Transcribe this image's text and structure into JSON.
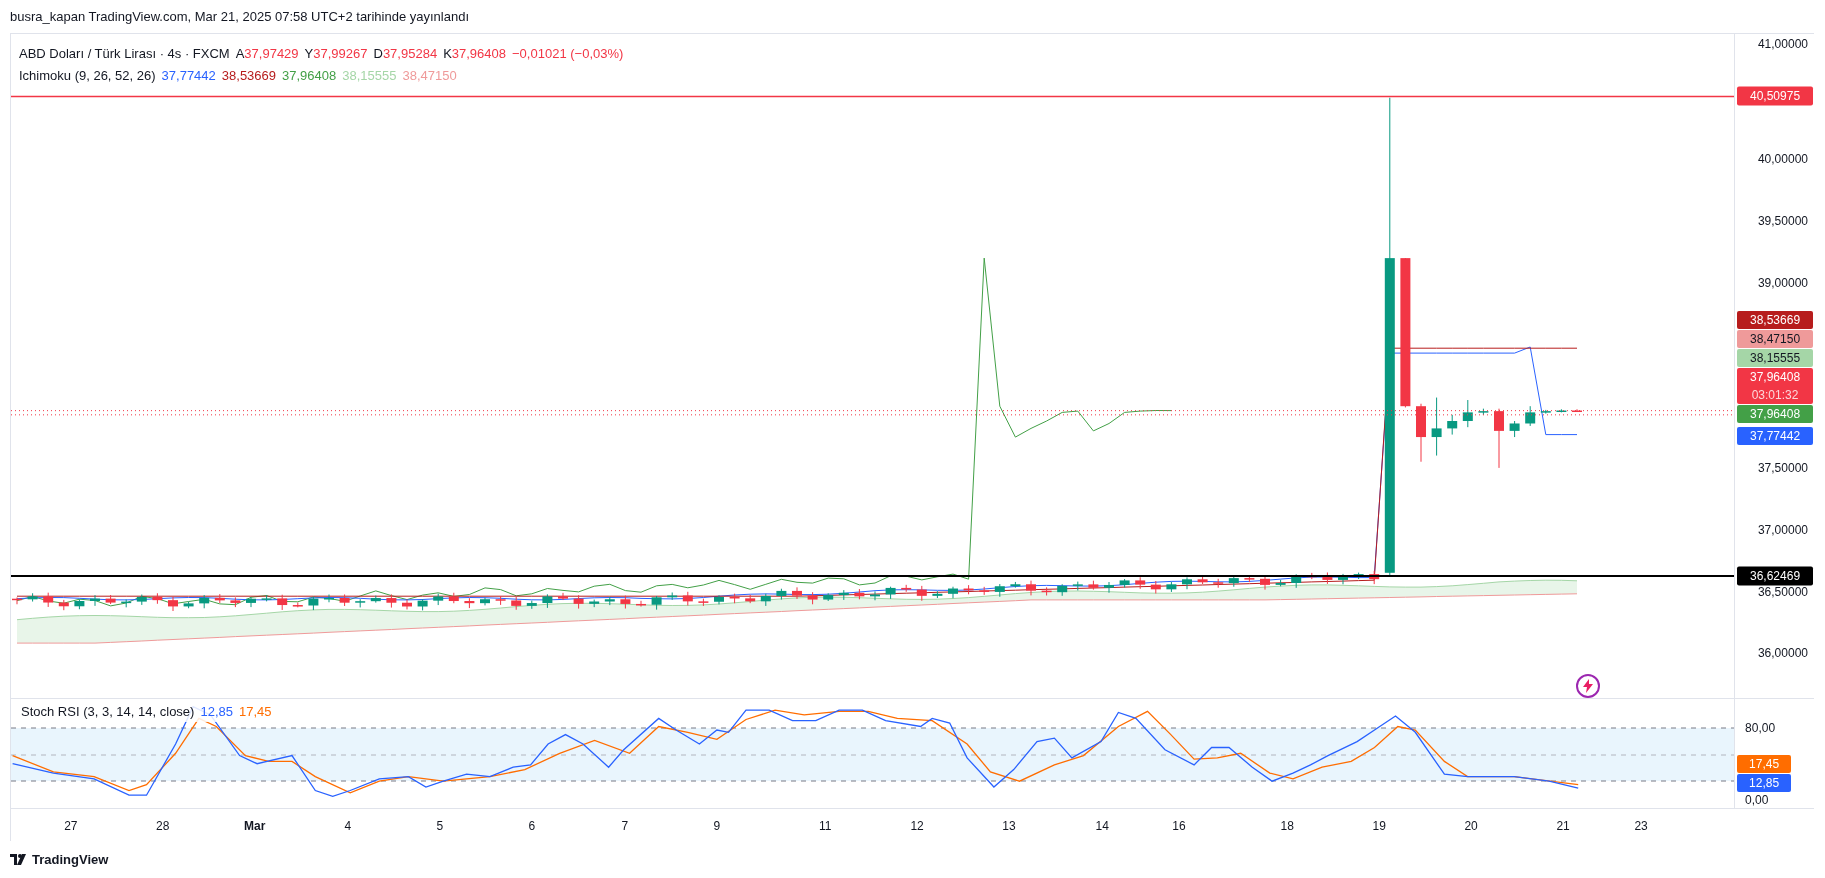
{
  "header": {
    "text": "busra_kapan TradingView.com, Mar 21, 2025 07:58 UTC+2 tarihinde yayınlandı"
  },
  "symbol": {
    "name": "ABD Doları / Türk Lirası · 4s · FXCM",
    "ohlc": [
      {
        "label": "A",
        "value": "37,97429"
      },
      {
        "label": "Y",
        "value": "37,99267"
      },
      {
        "label": "D",
        "value": "37,95284"
      },
      {
        "label": "K",
        "value": "37,96408"
      }
    ],
    "change": "−0,01021 (−0,03%)"
  },
  "ichimoku": {
    "label": "Ichimoku (9, 26, 52, 26)",
    "values": [
      {
        "text": "37,77442",
        "color": "#2962ff"
      },
      {
        "text": "38,53669",
        "color": "#b71c1c"
      },
      {
        "text": "37,96408",
        "color": "#43a047"
      },
      {
        "text": "38,15555",
        "color": "#a5d6a7"
      },
      {
        "text": "38,47150",
        "color": "#ef9a9a"
      }
    ]
  },
  "price_axis": [
    "41,00000",
    "40,00000",
    "39,50000",
    "39,00000",
    "37,50000",
    "37,00000",
    "36,50000",
    "36,00000"
  ],
  "price_tags": [
    {
      "text": "38,53669",
      "color": "#b71c1c"
    },
    {
      "text": "38,47150",
      "color": "#ef9a9a"
    },
    {
      "text": "38,15555",
      "color": "#a5d6a7"
    },
    {
      "text": "37,96408",
      "countdown": "03:01:32",
      "color": "#f23645"
    },
    {
      "text": "37,96408",
      "color": "#43a047"
    },
    {
      "text": "37,77442",
      "color": "#2962ff"
    }
  ],
  "level_tags": [
    {
      "text": "40,50975",
      "color": "#f23645"
    },
    {
      "text": "36,62469",
      "color": "#000000"
    }
  ],
  "stoch": {
    "label": "Stoch RSI (3, 3, 14, 14, close)",
    "values": [
      {
        "text": "12,85",
        "color": "#2962ff"
      },
      {
        "text": "17,45",
        "color": "#ff6d00"
      }
    ],
    "axis": [
      "80,00",
      "0,00"
    ],
    "tags": [
      {
        "text": "17,45",
        "color": "#ff6d00"
      },
      {
        "text": "12,85",
        "color": "#2962ff"
      }
    ]
  },
  "time_axis": [
    {
      "text": "27",
      "month": false
    },
    {
      "text": "28",
      "month": false
    },
    {
      "text": "Mar",
      "month": true
    },
    {
      "text": "4",
      "month": false
    },
    {
      "text": "5",
      "month": false
    },
    {
      "text": "6",
      "month": false
    },
    {
      "text": "7",
      "month": false
    },
    {
      "text": "9",
      "month": false
    },
    {
      "text": "11",
      "month": false
    },
    {
      "text": "12",
      "month": false
    },
    {
      "text": "13",
      "month": false
    },
    {
      "text": "14",
      "month": false
    },
    {
      "text": "16",
      "month": false
    },
    {
      "text": "18",
      "month": false
    },
    {
      "text": "19",
      "month": false
    },
    {
      "text": "20",
      "month": false
    },
    {
      "text": "21",
      "month": false
    },
    {
      "text": "23",
      "month": false
    }
  ],
  "footer": {
    "brand": "TradingView"
  }
}
